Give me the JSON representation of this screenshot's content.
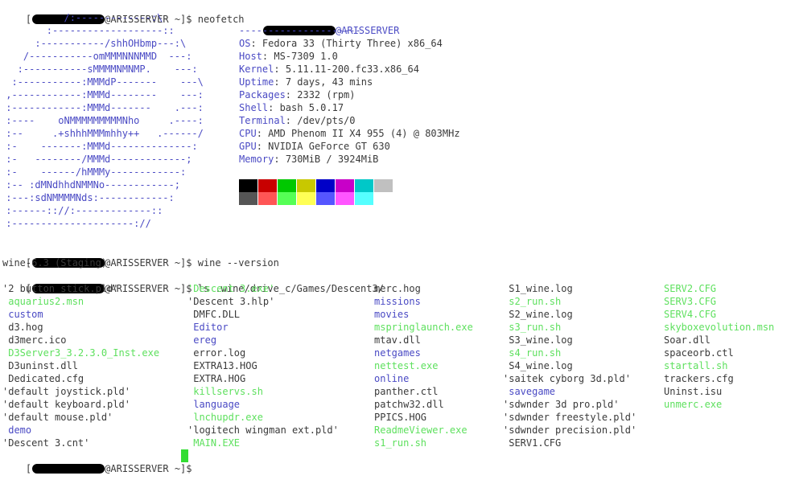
{
  "prompt": {
    "user_redacted": "[",
    "host": "@ARISSERVER ~]$ "
  },
  "commands": {
    "neofetch": "neofetch",
    "wine_version": "wine --version",
    "ls": "ls .wine/drive_c/Games/Descent3/"
  },
  "neofetch": {
    "header_host": "@ARISSERVER",
    "header_rule": "---------------------",
    "art": [
      "           /:-------------:\\",
      "        :-------------------::",
      "      :-----------/shhOHbmp---:\\",
      "    /-----------omMMMNNNMMD  ---:",
      "   :-----------sMMMMNMNMP.    ---:",
      "  :-----------:MMMdP-------    ---\\",
      " ,------------:MMMd--------    ---:",
      " :------------:MMMd-------    .---:",
      " :----    oNMMMMMMMMMNho     .----:",
      " :--     .+shhhMMMmhhy++   .------/",
      " :-    -------:MMMd--------------:",
      " :-   --------/MMMd-------------;",
      " :-    ------/hMMMy------------:",
      " :-- :dMNdhhdNMMNo------------;",
      " :---:sdNMMMMNds:------------:",
      " :------:://:-------------::",
      " :---------------------://"
    ],
    "info": [
      {
        "label": "OS",
        "value": "Fedora 33 (Thirty Three) x86_64"
      },
      {
        "label": "Host",
        "value": "MS-7309 1.0"
      },
      {
        "label": "Kernel",
        "value": "5.11.11-200.fc33.x86_64"
      },
      {
        "label": "Uptime",
        "value": "7 days, 43 mins"
      },
      {
        "label": "Packages",
        "value": "2332 (rpm)"
      },
      {
        "label": "Shell",
        "value": "bash 5.0.17"
      },
      {
        "label": "Terminal",
        "value": "/dev/pts/0"
      },
      {
        "label": "CPU",
        "value": "AMD Phenom II X4 955 (4) @ 803MHz"
      },
      {
        "label": "GPU",
        "value": "NVIDIA GeForce GT 630"
      },
      {
        "label": "Memory",
        "value": "730MiB / 3924MiB"
      }
    ],
    "label_sep": ": ",
    "palette_top": [
      "#000000",
      "#c80000",
      "#00c800",
      "#c8c800",
      "#0000c8",
      "#c800c8",
      "#00c8c8",
      "#c0c0c0"
    ],
    "palette_bottom": [
      "#555555",
      "#ff5555",
      "#55ff55",
      "#ffff55",
      "#5555ff",
      "#ff55ff",
      "#55ffff",
      "#ffffff"
    ]
  },
  "wine_output": "wine-6.3 (Staging)",
  "ls_columns": [
    [
      {
        "t": "'2 button stick.pld'",
        "c": "plain"
      },
      {
        "t": " aquarius2.msn",
        "c": "green"
      },
      {
        "t": " custom",
        "c": "blue"
      },
      {
        "t": " d3.hog",
        "c": "plain"
      },
      {
        "t": " d3merc.ico",
        "c": "plain"
      },
      {
        "t": " D3Server3_3.2.3.0_Inst.exe",
        "c": "green"
      },
      {
        "t": " D3uninst.dll",
        "c": "plain"
      },
      {
        "t": " Dedicated.cfg",
        "c": "plain"
      },
      {
        "t": "'default joystick.pld'",
        "c": "plain"
      },
      {
        "t": "'default keyboard.pld'",
        "c": "plain"
      },
      {
        "t": "'default mouse.pld'",
        "c": "plain"
      },
      {
        "t": " demo",
        "c": "blue"
      },
      {
        "t": "'Descent 3.cnt'",
        "c": "plain"
      }
    ],
    [
      {
        "t": "'Descent 3.exe'",
        "c": "green"
      },
      {
        "t": "'Descent 3.hlp'",
        "c": "plain"
      },
      {
        "t": " DMFC.DLL",
        "c": "plain"
      },
      {
        "t": " Editor",
        "c": "blue"
      },
      {
        "t": " ereg",
        "c": "blue"
      },
      {
        "t": " error.log",
        "c": "plain"
      },
      {
        "t": " EXTRA13.HOG",
        "c": "plain"
      },
      {
        "t": " EXTRA.HOG",
        "c": "plain"
      },
      {
        "t": " killservs.sh",
        "c": "green"
      },
      {
        "t": " language",
        "c": "blue"
      },
      {
        "t": " lnchupdr.exe",
        "c": "green"
      },
      {
        "t": "'logitech wingman ext.pld'",
        "c": "plain"
      },
      {
        "t": " MAIN.EXE",
        "c": "green"
      }
    ],
    [
      {
        "t": "merc.hog",
        "c": "plain"
      },
      {
        "t": "missions",
        "c": "blue"
      },
      {
        "t": "movies",
        "c": "blue"
      },
      {
        "t": "mspringlaunch.exe",
        "c": "green"
      },
      {
        "t": "mtav.dll",
        "c": "plain"
      },
      {
        "t": "netgames",
        "c": "blue"
      },
      {
        "t": "nettest.exe",
        "c": "green"
      },
      {
        "t": "online",
        "c": "blue"
      },
      {
        "t": "panther.ctl",
        "c": "plain"
      },
      {
        "t": "patchw32.dll",
        "c": "plain"
      },
      {
        "t": "PPICS.HOG",
        "c": "plain"
      },
      {
        "t": "ReadmeViewer.exe",
        "c": "green"
      },
      {
        "t": "s1_run.sh",
        "c": "green"
      }
    ],
    [
      {
        "t": " S1_wine.log",
        "c": "plain"
      },
      {
        "t": " s2_run.sh",
        "c": "green"
      },
      {
        "t": " S2_wine.log",
        "c": "plain"
      },
      {
        "t": " s3_run.sh",
        "c": "green"
      },
      {
        "t": " S3_wine.log",
        "c": "plain"
      },
      {
        "t": " s4_run.sh",
        "c": "green"
      },
      {
        "t": " S4_wine.log",
        "c": "plain"
      },
      {
        "t": "'saitek cyborg 3d.pld'",
        "c": "plain"
      },
      {
        "t": " savegame",
        "c": "blue"
      },
      {
        "t": "'sdwnder 3d pro.pld'",
        "c": "plain"
      },
      {
        "t": "'sdwnder freestyle.pld'",
        "c": "plain"
      },
      {
        "t": "'sdwnder precision.pld'",
        "c": "plain"
      },
      {
        "t": " SERV1.CFG",
        "c": "plain"
      }
    ],
    [
      {
        "t": "SERV2.CFG",
        "c": "green"
      },
      {
        "t": "SERV3.CFG",
        "c": "green"
      },
      {
        "t": "SERV4.CFG",
        "c": "green"
      },
      {
        "t": "skyboxevolution.msn",
        "c": "green"
      },
      {
        "t": "Soar.dll",
        "c": "plain"
      },
      {
        "t": "spaceorb.ctl",
        "c": "plain"
      },
      {
        "t": "startall.sh",
        "c": "green"
      },
      {
        "t": "trackers.cfg",
        "c": "plain"
      },
      {
        "t": "Uninst.isu",
        "c": "plain"
      },
      {
        "t": "unmerc.exe",
        "c": "green"
      }
    ]
  ],
  "colors": {
    "green": "#5ee05e",
    "blue": "#4a4ac4",
    "plain": "#3a3a3a",
    "cursor": "#33dd33"
  }
}
